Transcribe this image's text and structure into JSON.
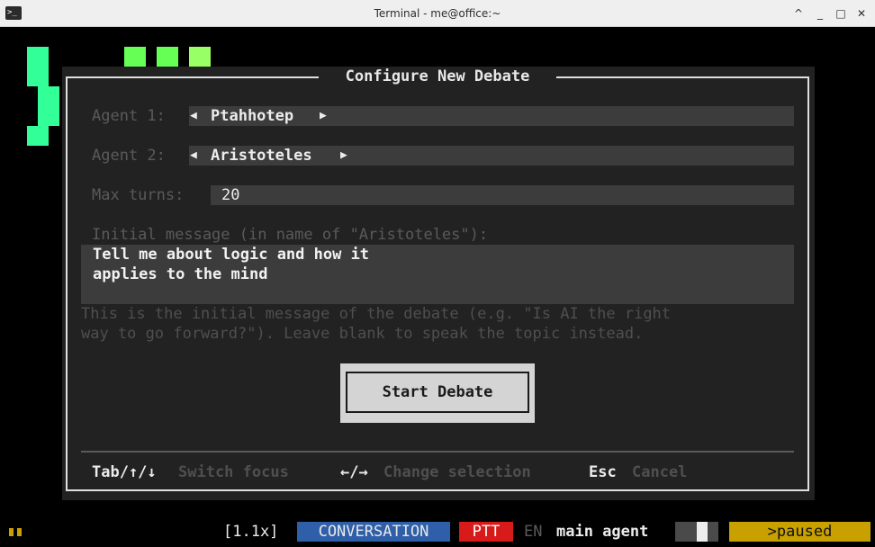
{
  "window": {
    "title": "Terminal - me@office:~",
    "app_icon_glyph": ">_"
  },
  "dialog": {
    "title": "Configure New Debate",
    "agent1": {
      "label": "Agent 1:",
      "value": "Ptahhotep"
    },
    "agent2": {
      "label": "Agent 2:",
      "value": "Aristoteles"
    },
    "max_turns": {
      "label": "Max turns:",
      "value": "20"
    },
    "initial_message": {
      "label": "Initial message (in name of \"Aristoteles\"):",
      "lines": [
        "Tell me about logic and how it",
        "applies to the mind"
      ]
    },
    "hint_lines": [
      "This is the initial message of the debate (e.g. \"Is AI the right",
      "way to go forward?\"). Leave blank to speak the topic instead."
    ],
    "start_button": "Start Debate",
    "shortcuts": [
      {
        "key": "Tab/↑/↓",
        "action": "Switch focus"
      },
      {
        "key": "←/→",
        "action": "Change selection"
      },
      {
        "key": "Esc",
        "action": "Cancel"
      }
    ]
  },
  "statusbar": {
    "speed": "[1.1x]",
    "mode": "CONVERSATION",
    "ptt": "PTT",
    "lang": "EN",
    "agent": "main agent",
    "state": ">paused"
  },
  "colors": {
    "accent_green": "#33ff99",
    "light_green": "#66ff55",
    "mode_blue": "#2f5fa8",
    "ptt_red": "#d71a1a",
    "paused_yellow": "#c8a000"
  }
}
